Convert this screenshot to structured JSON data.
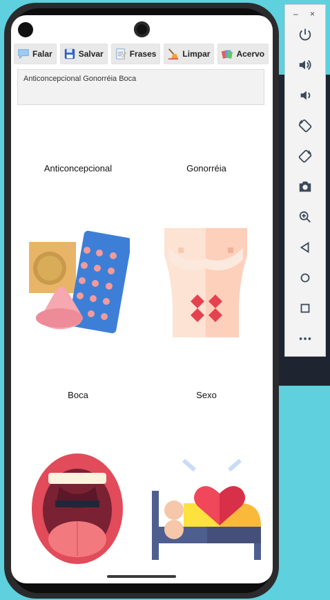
{
  "toolbar": {
    "buttons": [
      {
        "label": "Falar",
        "icon": "speech-bubble-icon"
      },
      {
        "label": "Salvar",
        "icon": "floppy-disk-icon"
      },
      {
        "label": "Frases",
        "icon": "notepad-icon"
      },
      {
        "label": "Limpar",
        "icon": "broom-icon"
      },
      {
        "label": "Acervo",
        "icon": "cards-icon"
      }
    ]
  },
  "sentence_box": {
    "text": "Anticoncepcional Gonorréia Boca"
  },
  "cards": [
    {
      "label": "Anticoncepcional",
      "icon": "contraceptive-icon"
    },
    {
      "label": "Gonorréia",
      "icon": "torso-rash-icon"
    },
    {
      "label": "Boca",
      "icon": "open-mouth-icon"
    },
    {
      "label": "Sexo",
      "icon": "bed-heart-icon"
    }
  ],
  "emulator_panel": {
    "window_controls": [
      "–",
      "×"
    ],
    "buttons": [
      "power-icon",
      "volume-up-icon",
      "volume-down-icon",
      "rotate-left-icon",
      "rotate-right-icon",
      "camera-icon",
      "zoom-icon",
      "back-icon",
      "home-icon",
      "overview-icon",
      "more-icon"
    ]
  },
  "colors": {
    "background": "#5fd0dd",
    "screen": "#ffffff",
    "toolbar_button": "#e9e9e9"
  }
}
